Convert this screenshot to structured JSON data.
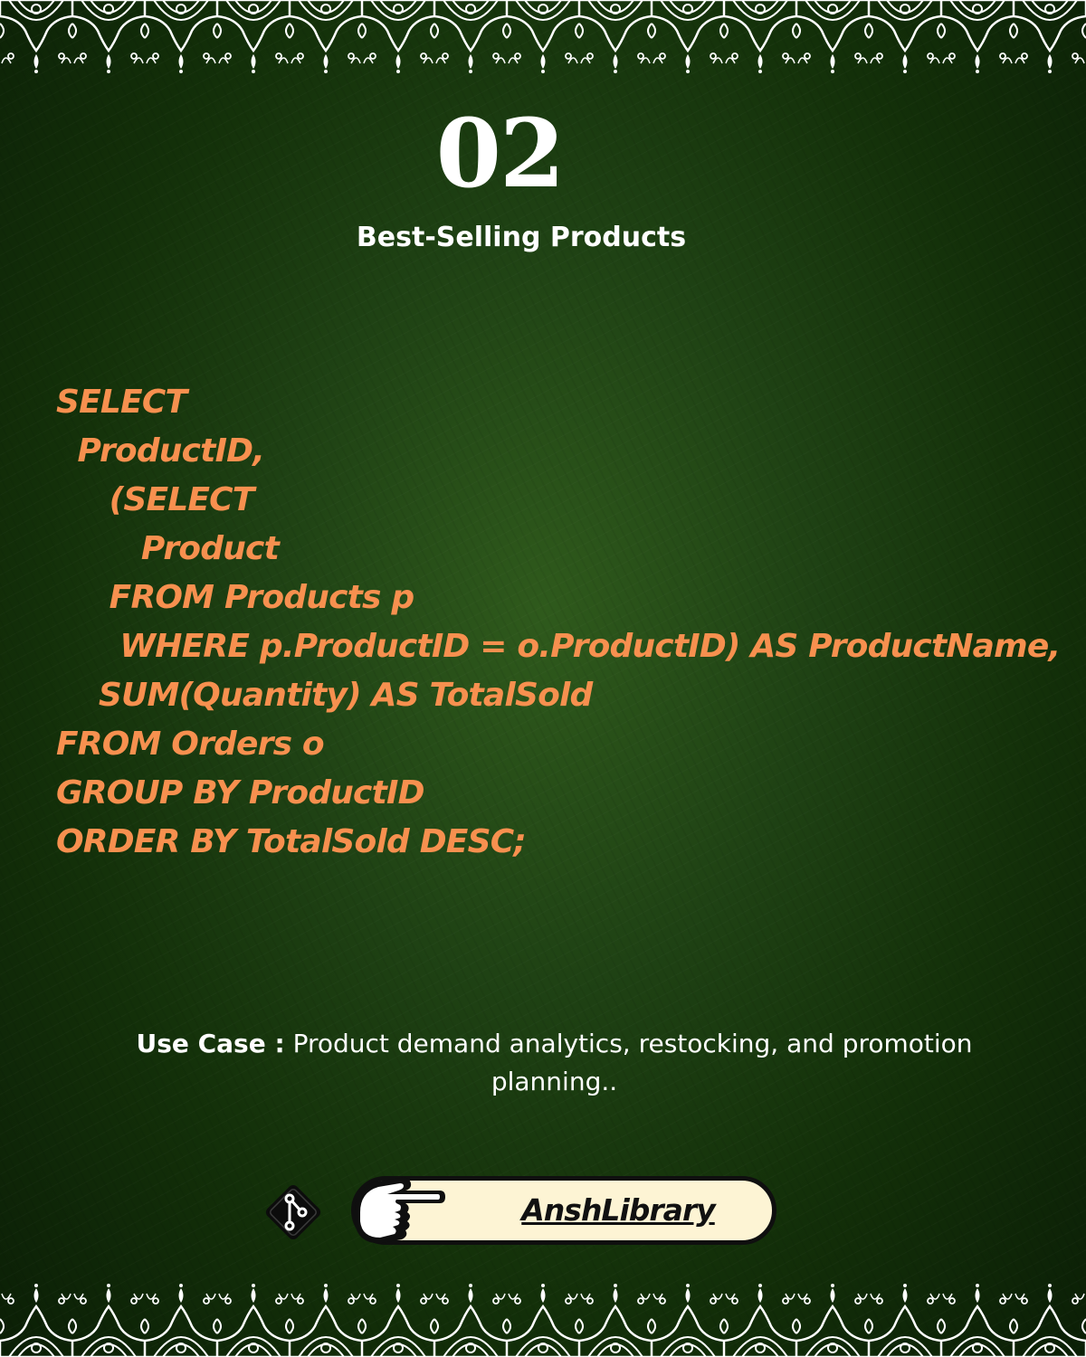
{
  "slide": {
    "number": "02",
    "title": "Best-Selling Products"
  },
  "code": {
    "lines": [
      "SELECT",
      "  ProductID,",
      "     (SELECT",
      "        Product",
      "     FROM Products p",
      "      WHERE p.ProductID = o.ProductID) AS ProductName,",
      "    SUM(Quantity) AS TotalSold",
      "FROM Orders o",
      "GROUP BY ProductID",
      "ORDER BY TotalSold DESC;"
    ]
  },
  "use_case": {
    "label": "Use Case :",
    "text": "Product demand analytics, restocking, and promotion planning.."
  },
  "footer": {
    "brand": "AnshLibrary",
    "git_icon": "git-branch-icon",
    "hand_icon": "pointing-hand-icon"
  },
  "colors": {
    "background": "#1f4214",
    "code": "#f7904f",
    "text": "#ffffff",
    "pill": "#fdf4d4"
  }
}
